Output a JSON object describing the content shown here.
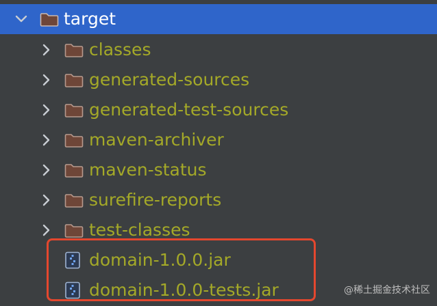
{
  "tree": {
    "root": {
      "label": "target",
      "expanded": true,
      "selected": true,
      "icon": "folder-icon",
      "chevron": "chevron-down-icon"
    },
    "children": [
      {
        "label": "classes",
        "icon": "folder-icon",
        "chevron": "chevron-right-icon"
      },
      {
        "label": "generated-sources",
        "icon": "folder-icon",
        "chevron": "chevron-right-icon"
      },
      {
        "label": "generated-test-sources",
        "icon": "folder-icon",
        "chevron": "chevron-right-icon"
      },
      {
        "label": "maven-archiver",
        "icon": "folder-icon",
        "chevron": "chevron-right-icon"
      },
      {
        "label": "maven-status",
        "icon": "folder-icon",
        "chevron": "chevron-right-icon"
      },
      {
        "label": "surefire-reports",
        "icon": "folder-icon",
        "chevron": "chevron-right-icon"
      },
      {
        "label": "test-classes",
        "icon": "folder-icon",
        "chevron": "chevron-right-icon"
      },
      {
        "label": "domain-1.0.0.jar",
        "icon": "jar-file-icon"
      },
      {
        "label": "domain-1.0.0-tests.jar",
        "icon": "jar-file-icon"
      }
    ]
  },
  "colors": {
    "background": "#3c3f41",
    "selection": "#2f65ca",
    "excluded_label": "#a4a928",
    "folder_fill": "#8a4f3c",
    "jar_accent": "#3d7bd9",
    "highlight_border": "#e4472e"
  },
  "watermark": "@稀土掘金技术社区"
}
